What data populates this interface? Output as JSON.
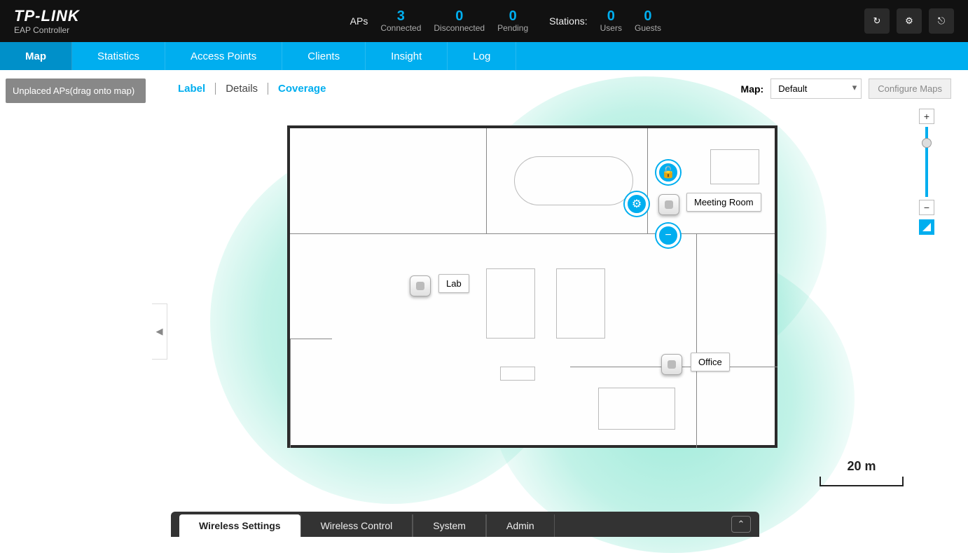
{
  "brand": {
    "name": "TP-LINK",
    "product": "EAP Controller"
  },
  "header_stats": {
    "aps_label": "APs",
    "aps": [
      {
        "value": "3",
        "label": "Connected"
      },
      {
        "value": "0",
        "label": "Disconnected"
      },
      {
        "value": "0",
        "label": "Pending"
      }
    ],
    "stations_label": "Stations:",
    "stations": [
      {
        "value": "0",
        "label": "Users"
      },
      {
        "value": "0",
        "label": "Guests"
      }
    ]
  },
  "nav": {
    "tabs": [
      "Map",
      "Statistics",
      "Access Points",
      "Clients",
      "Insight",
      "Log"
    ],
    "active": "Map"
  },
  "sidebar": {
    "unplaced_header": "Unplaced APs(drag onto map)"
  },
  "view_toggles": {
    "label": "Label",
    "details": "Details",
    "coverage": "Coverage"
  },
  "map_toolbar": {
    "label": "Map:",
    "selected": "Default",
    "configure": "Configure Maps"
  },
  "aps_on_map": [
    {
      "id": "meeting-room",
      "label": "Meeting Room"
    },
    {
      "id": "lab",
      "label": "Lab"
    },
    {
      "id": "office",
      "label": "Office"
    }
  ],
  "scale": {
    "text": "20 m"
  },
  "bottom_tabs": {
    "wireless_settings": "Wireless Settings",
    "wireless_control": "Wireless Control",
    "system": "System",
    "admin": "Admin"
  },
  "icons": {
    "reload": "↻",
    "settings": "⚙",
    "logout": "⎋",
    "lock": "🔓",
    "gear": "⚙",
    "minus": "−",
    "plus": "+",
    "chevron_left": "◀",
    "chevron_up": "⌃",
    "triangle": "◣"
  }
}
